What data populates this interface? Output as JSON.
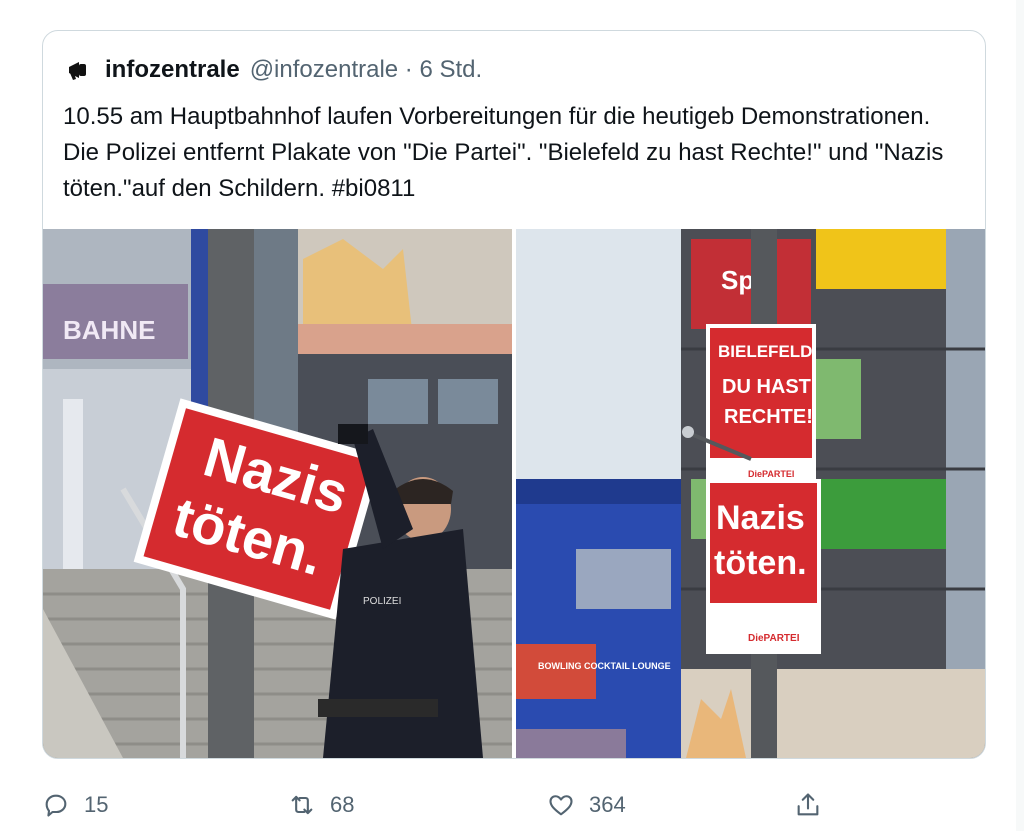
{
  "tweet": {
    "display_name": "infozentrale",
    "handle_time": "@infozentrale · 6 Std.",
    "text": "10.55 am Hauptbahnhof laufen Vorbereitungen für die heutigeb Demonstrationen. Die Polizei entfernt Plakate von \"Die Partei\". \"Bielefeld zu hast Rechte!\" und \"Nazis töten.\"auf den Schildern. #bi0811"
  },
  "photo_left": {
    "sign_line1": "Nazis",
    "sign_line2": "töten.",
    "building_sign": "BAHNE",
    "badge": "POLIZEI"
  },
  "photo_right": {
    "poster_top_l1": "BIELEFELD",
    "poster_top_l2": "DU HAST",
    "poster_top_l3": "RECHTE!",
    "poster_bottom_l1": "Nazis",
    "poster_bottom_l2": "töten.",
    "party": "DiePARTEI",
    "bank": "Spa",
    "bowling": "BOWLING COCKTAIL LOUNGE"
  },
  "actions": {
    "reply_count": "15",
    "retweet_count": "68",
    "like_count": "364"
  },
  "colors": {
    "accent_red": "#d52b2f",
    "muted": "#536471",
    "border": "#cfd9de"
  },
  "icons": [
    "megaphone-icon",
    "reply-icon",
    "retweet-icon",
    "like-icon",
    "share-icon"
  ]
}
